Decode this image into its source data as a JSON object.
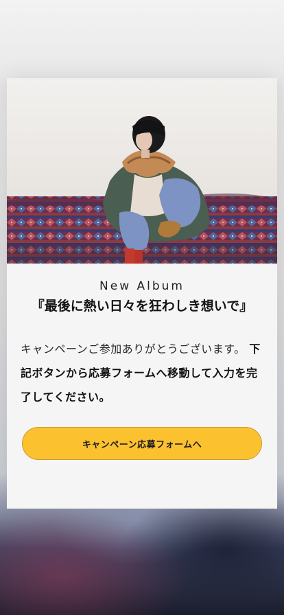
{
  "modal": {
    "album_caption": "New Album",
    "album_title": "『最後に熱い日々を狂わしき想いで』",
    "message_part1": "キャンペーンご参加ありがとうございます。",
    "message_part2": "下記ボタンから応募フォームへ移動して入力を完了してください。",
    "cta_label": "キャンペーン応募フォームへ",
    "cta_color": "#fcc12f"
  }
}
